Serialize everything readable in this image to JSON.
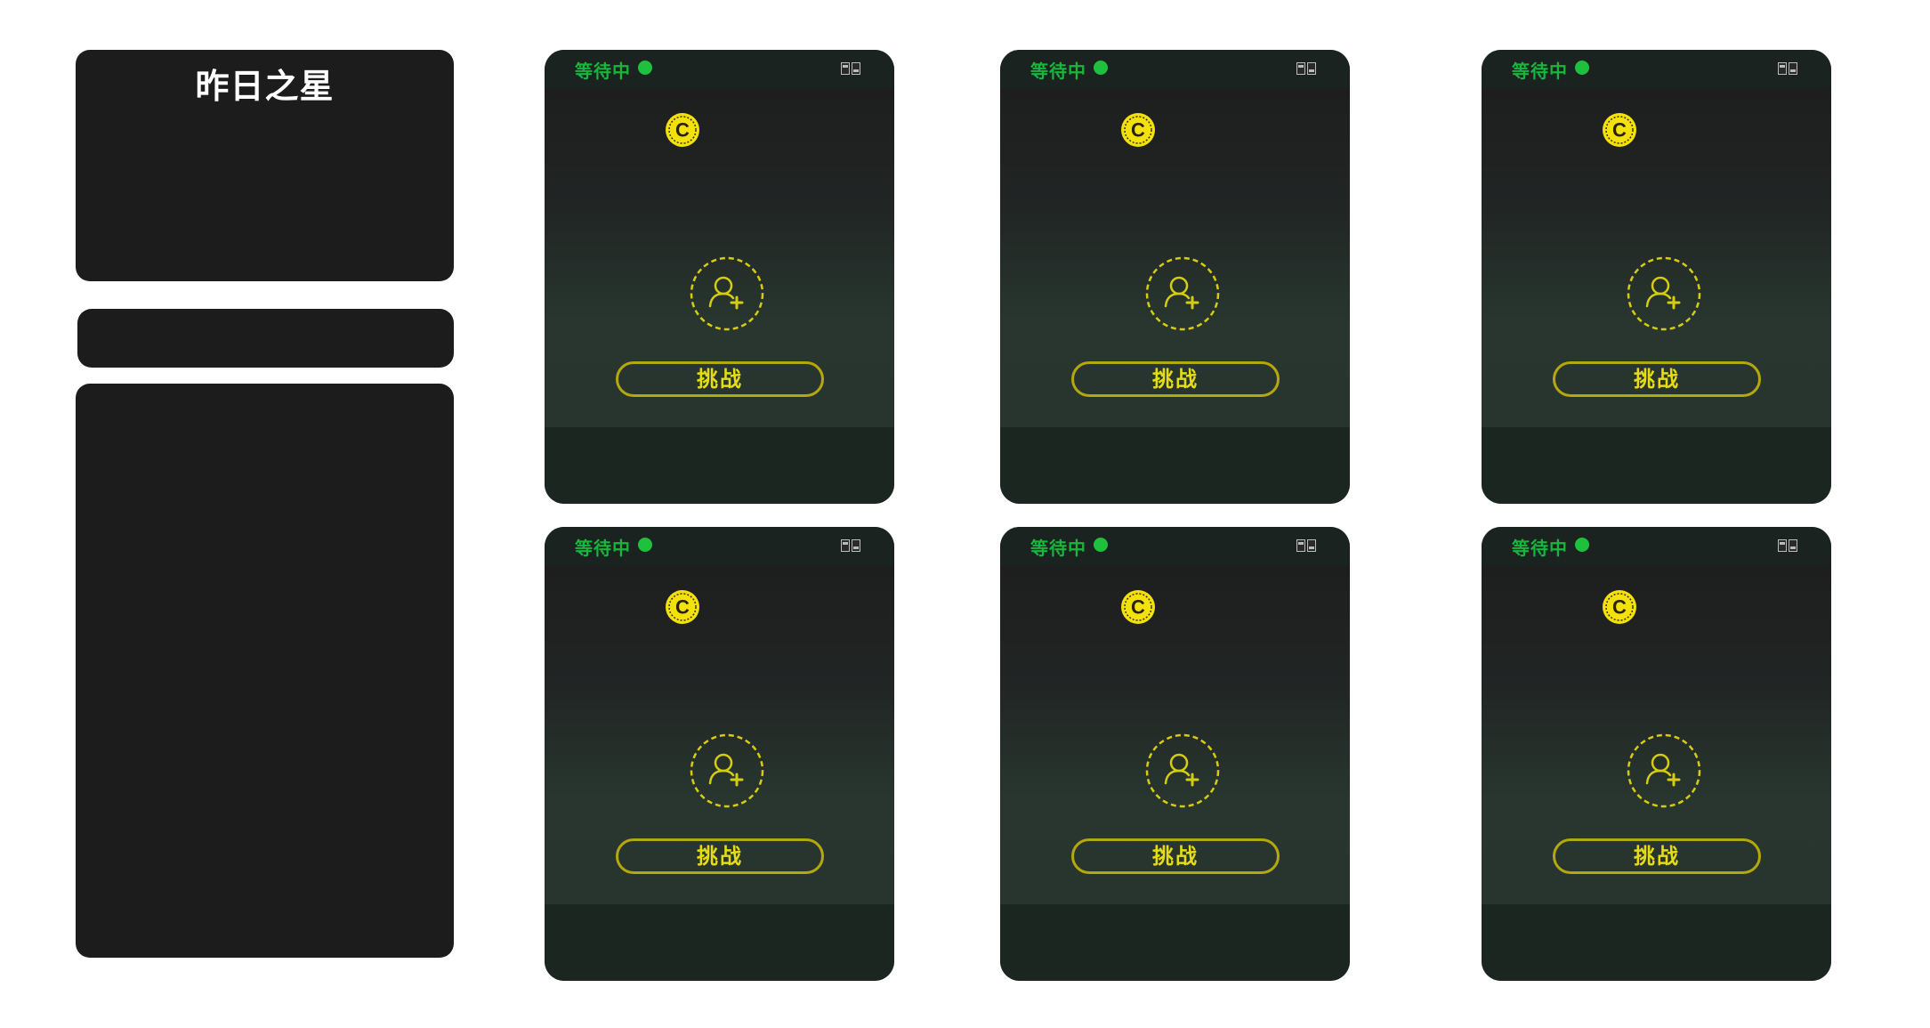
{
  "left_panel": {
    "star_title": "昨日之星"
  },
  "colors": {
    "accent_yellow": "#e6dc16",
    "status_green": "#19b53e",
    "panel_dark": "#1c1c1c"
  },
  "cards": [
    {
      "status": "等待中",
      "challenge_label": "挑战",
      "coin_icon": "coin-c-icon",
      "add_icon": "add-user-icon"
    },
    {
      "status": "等待中",
      "challenge_label": "挑战",
      "coin_icon": "coin-c-icon",
      "add_icon": "add-user-icon"
    },
    {
      "status": "等待中",
      "challenge_label": "挑战",
      "coin_icon": "coin-c-icon",
      "add_icon": "add-user-icon"
    },
    {
      "status": "等待中",
      "challenge_label": "挑战",
      "coin_icon": "coin-c-icon",
      "add_icon": "add-user-icon"
    },
    {
      "status": "等待中",
      "challenge_label": "挑战",
      "coin_icon": "coin-c-icon",
      "add_icon": "add-user-icon"
    },
    {
      "status": "等待中",
      "challenge_label": "挑战",
      "coin_icon": "coin-c-icon",
      "add_icon": "add-user-icon"
    }
  ]
}
